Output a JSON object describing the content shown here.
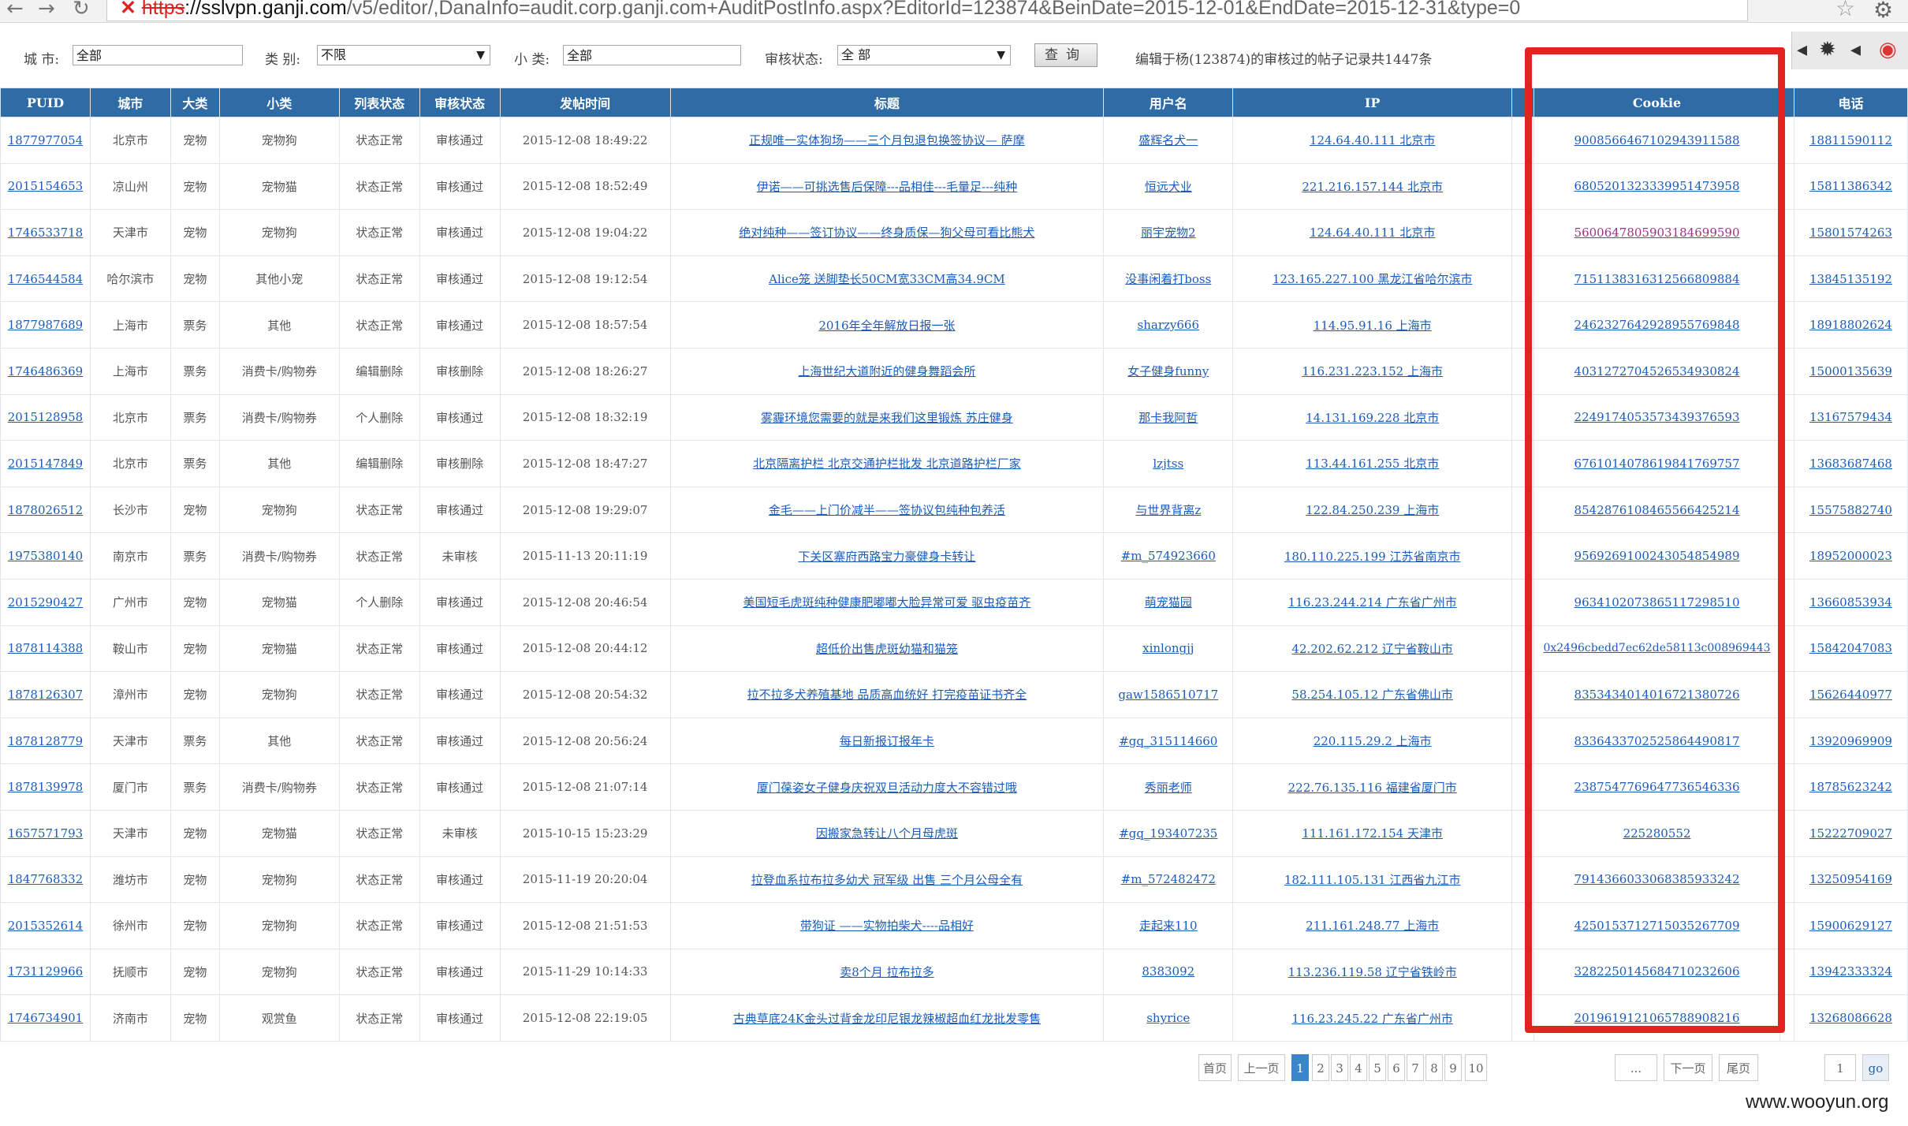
{
  "browser": {
    "url_scheme": "https",
    "url_host": "://sslvpn.ganji.com",
    "url_rest": "/v5/editor/,DanaInfo=audit.corp.ganji.com+AuditPostInfo.aspx?EditorId=123874&BeinDate=2015-12-01&EndDate=2015-12-31&type=0"
  },
  "filters": {
    "city_label": "城 市:",
    "city_value": "全部",
    "category_label": "类 别:",
    "category_value": "不限",
    "subcategory_label": "小 类:",
    "subcategory_value": "全部",
    "review_label": "审核状态:",
    "review_value": "全 部",
    "query_button": "查询",
    "summary": "编辑于杨(123874)的审核过的帖子记录共1447条"
  },
  "table": {
    "headers": [
      "PUID",
      "城市",
      "大类",
      "小类",
      "列表状态",
      "审核状态",
      "发帖时间",
      "标题",
      "用户名",
      "IP",
      "",
      "Cookie",
      "",
      "电话"
    ],
    "rows": [
      [
        "1877977054",
        "北京市",
        "宠物",
        "宠物狗",
        "状态正常",
        "审核通过",
        "2015-12-08 18:49:22",
        "正规唯一实体狗场——三个月包退包换签协议— 萨摩",
        "盛辉名犬一",
        "124.64.40.111 北京市",
        "",
        "9008566467102943911588",
        "",
        "18811590112"
      ],
      [
        "2015154653",
        "凉山州",
        "宠物",
        "宠物猫",
        "状态正常",
        "审核通过",
        "2015-12-08 18:52:49",
        "伊诺——可挑选售后保障---品相佳---毛量足---纯种",
        "恒远犬业",
        "221.216.157.144 北京市",
        "",
        "6805201323339951473958",
        "",
        "15811386342"
      ],
      [
        "1746533718",
        "天津市",
        "宠物",
        "宠物狗",
        "状态正常",
        "审核通过",
        "2015-12-08 19:04:22",
        "绝对纯种——签订协议——终身质保—狗父母可看比熊犬",
        "丽宇宠物2",
        "124.64.40.111 北京市",
        "",
        "5600647805903184699590",
        "",
        "15801574263"
      ],
      [
        "1746544584",
        "哈尔滨市",
        "宠物",
        "其他小宠",
        "状态正常",
        "审核通过",
        "2015-12-08 19:12:54",
        "Alice笼 送脚垫长50CM宽33CM高34.9CM",
        "没事闲着打boss",
        "123.165.227.100 黑龙江省哈尔滨市",
        "",
        "7151138316312566809884",
        "",
        "13845135192"
      ],
      [
        "1877987689",
        "上海市",
        "票务",
        "其他",
        "状态正常",
        "审核通过",
        "2015-12-08 18:57:54",
        "2016年全年解放日报一张",
        "sharzy666",
        "114.95.91.16 上海市",
        "",
        "2462327642928955769848",
        "",
        "18918802624"
      ],
      [
        "1746486369",
        "上海市",
        "票务",
        "消费卡/购物券",
        "编辑删除",
        "审核删除",
        "2015-12-08 18:26:27",
        "上海世纪大道附近的健身舞蹈会所",
        "女子健身funny",
        "116.231.223.152 上海市",
        "",
        "4031272704526534930824",
        "",
        "15000135639"
      ],
      [
        "2015128958",
        "北京市",
        "票务",
        "消费卡/购物券",
        "个人删除",
        "审核通过",
        "2015-12-08 18:32:19",
        "雾霾环境您需要的就是来我们这里锻炼 苏庄健身",
        "那卡我阿哲",
        "14.131.169.228 北京市",
        "",
        "2249174053573439376593",
        "",
        "13167579434"
      ],
      [
        "2015147849",
        "北京市",
        "票务",
        "其他",
        "编辑删除",
        "审核删除",
        "2015-12-08 18:47:27",
        "北京隔离护栏 北京交通护栏批发 北京道路护栏厂家",
        "lzjtss",
        "113.44.161.255 北京市",
        "",
        "6761014078619841769757",
        "",
        "13683687468"
      ],
      [
        "1878026512",
        "长沙市",
        "宠物",
        "宠物狗",
        "状态正常",
        "审核通过",
        "2015-12-08 19:29:07",
        "金毛——上门价减半——签协议包纯种包养活",
        "与世界背离z",
        "122.84.250.239 上海市",
        "",
        "8542876108465566425214",
        "",
        "15575882740"
      ],
      [
        "1975380140",
        "南京市",
        "票务",
        "消费卡/购物券",
        "状态正常",
        "未审核",
        "2015-11-13 20:11:19",
        "下关区寨府西路宝力豪健身卡转让",
        "#m_574923660",
        "180.110.225.199 江苏省南京市",
        "",
        "9569269100243054854989",
        "",
        "18952000023"
      ],
      [
        "2015290427",
        "广州市",
        "宠物",
        "宠物猫",
        "个人删除",
        "审核通过",
        "2015-12-08 20:46:54",
        "美国短毛虎斑纯种健康肥嘟嘟大脸异常可爱 驱虫疫苗齐",
        "萌宠猫园",
        "116.23.244.214 广东省广州市",
        "",
        "9634102073865117298510",
        "",
        "13660853934"
      ],
      [
        "1878114388",
        "鞍山市",
        "宠物",
        "宠物猫",
        "状态正常",
        "审核通过",
        "2015-12-08 20:44:12",
        "超低价出售虎斑幼猫和猫笼",
        "xinlongjj",
        "42.202.62.212 辽宁省鞍山市",
        "",
        "0x2496cbedd7ec62de58113c008969443",
        "",
        "15842047083"
      ],
      [
        "1878126307",
        "漳州市",
        "宠物",
        "宠物狗",
        "状态正常",
        "审核通过",
        "2015-12-08 20:54:32",
        "拉不拉多犬养殖基地 品质高血统好 打完疫苗证书齐全",
        "gaw1586510717",
        "58.254.105.12 广东省佛山市",
        "",
        "8353434014016721380726",
        "",
        "15626440977"
      ],
      [
        "1878128779",
        "天津市",
        "票务",
        "其他",
        "状态正常",
        "审核通过",
        "2015-12-08 20:56:24",
        "每日新报订报年卡",
        "#gq_315114660",
        "220.115.29.2 上海市",
        "",
        "8336433702525864490817",
        "",
        "13920969909"
      ],
      [
        "1878139978",
        "厦门市",
        "票务",
        "消费卡/购物券",
        "状态正常",
        "审核通过",
        "2015-12-08 21:07:14",
        "厦门葆姿女子健身庆祝双旦活动力度大不容错过哦",
        "秀丽老师",
        "222.76.135.116 福建省厦门市",
        "",
        "2387547769647736546336",
        "",
        "18785623242"
      ],
      [
        "1657571793",
        "天津市",
        "宠物",
        "宠物猫",
        "状态正常",
        "未审核",
        "2015-10-15 15:23:29",
        "因搬家急转让八个月母虎斑",
        "#gq_193407235",
        "111.161.172.154 天津市",
        "",
        "225280552",
        "",
        "15222709027"
      ],
      [
        "1847768332",
        "潍坊市",
        "宠物",
        "宠物狗",
        "状态正常",
        "审核通过",
        "2015-11-19 20:20:04",
        "拉登血系拉布拉多幼犬 冠军级 出售 三个月公母全有",
        "#m_572482472",
        "182.111.105.131 江西省九江市",
        "",
        "7914366033068385933242",
        "",
        "13250954169"
      ],
      [
        "2015352614",
        "徐州市",
        "宠物",
        "宠物狗",
        "状态正常",
        "审核通过",
        "2015-12-08 21:51:53",
        "带狗证 ——实物拍柴犬----品相好",
        "走起来110",
        "211.161.248.77 上海市",
        "",
        "4250153712715035267709",
        "",
        "15900629127"
      ],
      [
        "1731129966",
        "抚顺市",
        "宠物",
        "宠物狗",
        "状态正常",
        "审核通过",
        "2015-11-29 10:14:33",
        "卖8个月 拉布拉多",
        "8383092",
        "113.236.119.58 辽宁省铁岭市",
        "",
        "3282250145684710232606",
        "",
        "13942333324"
      ],
      [
        "1746734901",
        "济南市",
        "宠物",
        "观赏鱼",
        "状态正常",
        "审核通过",
        "2015-12-08 22:19:05",
        "古典草底24K金头过背金龙印尼银龙辣椒超血红龙批发零售",
        "shyrice",
        "116.23.245.22 广东省广州市",
        "",
        "2019619121065788908216",
        "",
        "13268086628"
      ]
    ]
  },
  "pagination": {
    "first": "首页",
    "prev": "上一页",
    "pages": [
      "1",
      "2",
      "3",
      "4",
      "5",
      "6",
      "7",
      "8",
      "9",
      "10"
    ],
    "ellipsis": "...",
    "next": "下一页",
    "last": "尾页",
    "page_input": "1",
    "go": "go"
  },
  "watermark": "www.wooyun.org",
  "colors": {
    "header_bg": "#2f6ca6",
    "link": "#1c5cb8",
    "visited_link": "#a02f86",
    "highlight": "#e3231e"
  }
}
